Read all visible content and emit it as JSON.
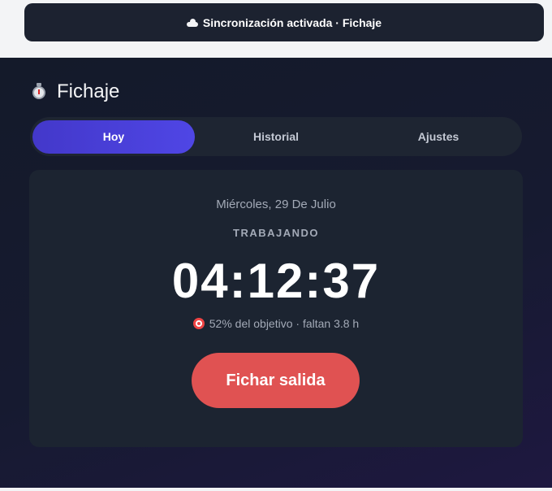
{
  "sync_banner": {
    "icon": "cloud-icon",
    "text": "Sincronización activada · Fichaje"
  },
  "header": {
    "icon": "stopwatch-icon",
    "title": "Fichaje"
  },
  "tabs": [
    {
      "label": "Hoy",
      "active": true
    },
    {
      "label": "Historial",
      "active": false
    },
    {
      "label": "Ajustes",
      "active": false
    }
  ],
  "today": {
    "date": "Miércoles, 29 De Julio",
    "status": "TRABAJANDO",
    "elapsed": "04:12:37",
    "progress_icon": "target-icon",
    "progress_text": "52% del objetivo · faltan 3.8 h",
    "clock_out_label": "Fichar salida"
  },
  "colors": {
    "accent": "#4338ca",
    "danger": "#e05252",
    "card": "#1c2431",
    "background": "#141a2a"
  }
}
